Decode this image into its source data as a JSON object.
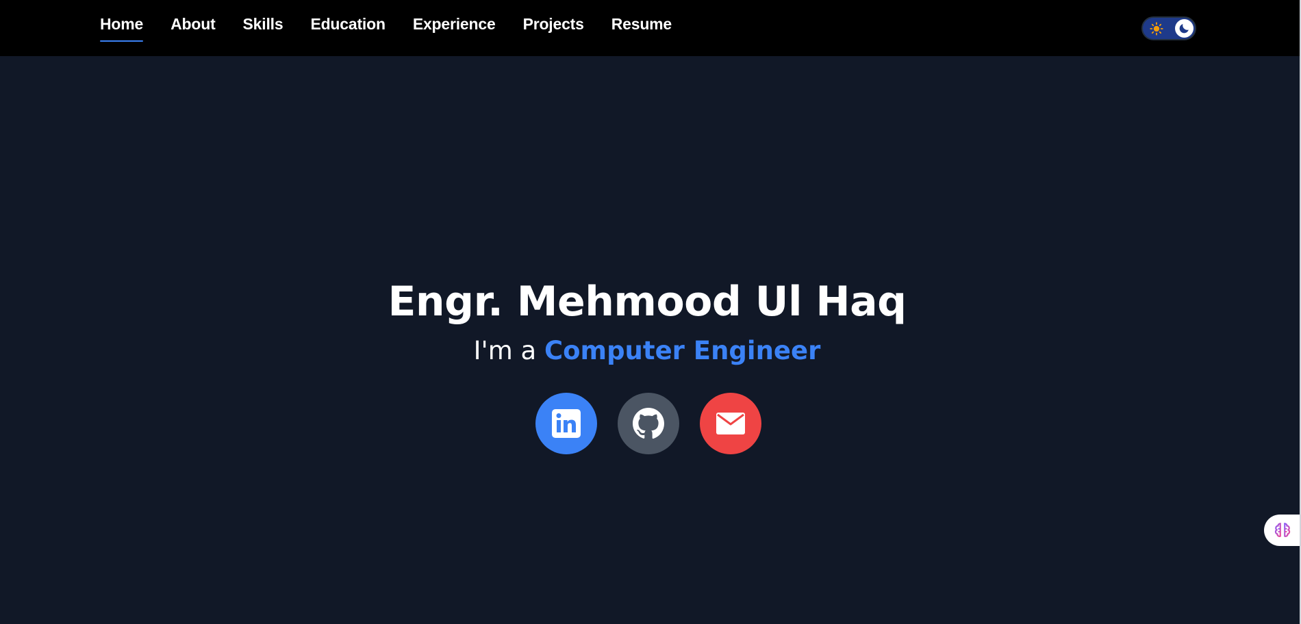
{
  "nav": {
    "items": [
      {
        "label": "Home",
        "active": true
      },
      {
        "label": "About"
      },
      {
        "label": "Skills"
      },
      {
        "label": "Education"
      },
      {
        "label": "Experience"
      },
      {
        "label": "Projects"
      },
      {
        "label": "Resume"
      }
    ]
  },
  "theme_toggle": {
    "mode": "dark",
    "icons": [
      "sun-icon",
      "moon-icon"
    ]
  },
  "hero": {
    "title": "Engr. Mehmood Ul Haq",
    "subtitle_prefix": "I'm a ",
    "subtitle_highlight": "Computer Engineer"
  },
  "socials": [
    {
      "name": "linkedin",
      "icon": "linkedin-icon",
      "color": "#3b82f6"
    },
    {
      "name": "github",
      "icon": "github-icon",
      "color": "#4b5563"
    },
    {
      "name": "email",
      "icon": "envelope-icon",
      "color": "#ef4444"
    }
  ],
  "floating_widget": {
    "icon": "brain-icon"
  },
  "colors": {
    "navbar_bg": "#000000",
    "page_bg": "#111827",
    "accent": "#3b82f6",
    "active_underline": "#3b82f6"
  }
}
